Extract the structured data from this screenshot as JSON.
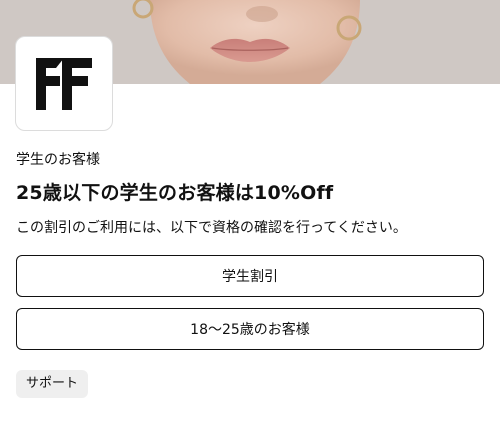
{
  "hero": {
    "image": "model-face-closeup-photo"
  },
  "brand": {
    "logo": "farfetch-ff-logo",
    "logo_color": "#111111"
  },
  "offer": {
    "eyebrow": "学生のお客様",
    "headline": "25歳以下の学生のお客様は10%Off",
    "description": "この割引のご利用には、以下で資格の確認を行ってください。"
  },
  "options": [
    {
      "label": "学生割引"
    },
    {
      "label": "18〜25歳のお客様"
    }
  ],
  "support": {
    "label": "サポート"
  },
  "colors": {
    "text": "#111111",
    "button_border": "#111111",
    "chip_background": "#efefef",
    "logo_border": "#dcdcdc"
  }
}
